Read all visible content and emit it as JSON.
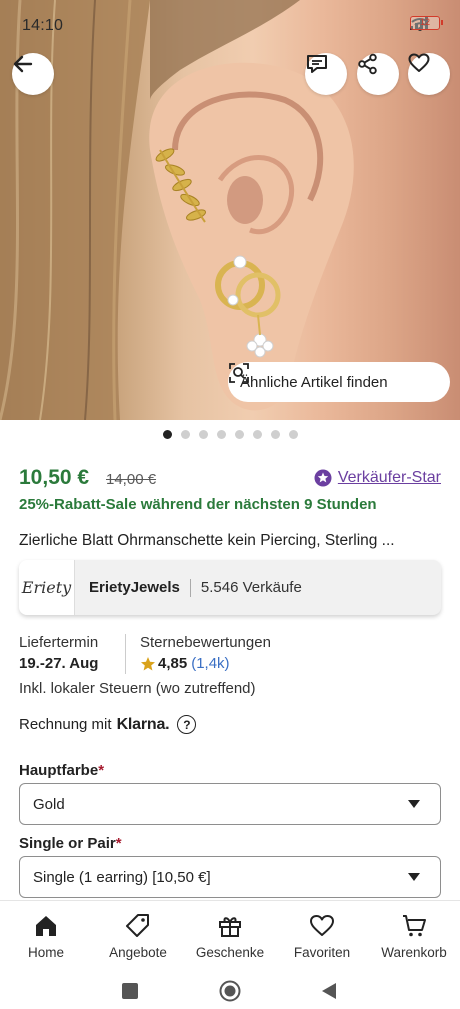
{
  "status_bar": {
    "time": "14:10",
    "battery": "12"
  },
  "gallery": {
    "similar_items_label": "Ähnliche Artikel finden",
    "image_count": 8,
    "active_index": 0
  },
  "listing": {
    "price": "10,50 €",
    "original_price": "14,00 €",
    "star_seller_label": "Verkäufer-Star",
    "sale_text": "25%-Rabatt-Sale während der nächsten  9 Stunden",
    "title": "Zierliche Blatt Ohrmanschette kein Piercing, Sterling ..."
  },
  "shop": {
    "logo_text": "Eriety",
    "name": "ErietyJewels",
    "sales": "5.546 Verkäufe"
  },
  "delivery": {
    "label": "Liefertermin",
    "value": "19.-27. Aug",
    "reviews_label": "Sternebewertungen",
    "rating": "4,85",
    "review_count": "(1,4k)",
    "taxes_note": "Inkl. lokaler Steuern (wo zutreffend)"
  },
  "payment": {
    "text": "Rechnung mit",
    "provider": "Klarna.",
    "help": "?"
  },
  "options": [
    {
      "label": "Hauptfarbe",
      "required_mark": "*",
      "selected": "Gold"
    },
    {
      "label": "Single or Pair",
      "required_mark": "*",
      "selected": "Single (1 earring) [10,50 €]"
    }
  ],
  "bottom_nav": [
    {
      "label": "Home",
      "icon": "home-icon"
    },
    {
      "label": "Angebote",
      "icon": "tag-icon"
    },
    {
      "label": "Geschenke",
      "icon": "gift-icon"
    },
    {
      "label": "Favoriten",
      "icon": "heart-icon"
    },
    {
      "label": "Warenkorb",
      "icon": "cart-icon"
    }
  ],
  "colors": {
    "price_green": "#2b7a3b",
    "star_seller_purple": "#6b3fa0",
    "required_red": "#a61a2e",
    "link_blue": "#3a6fc4"
  }
}
